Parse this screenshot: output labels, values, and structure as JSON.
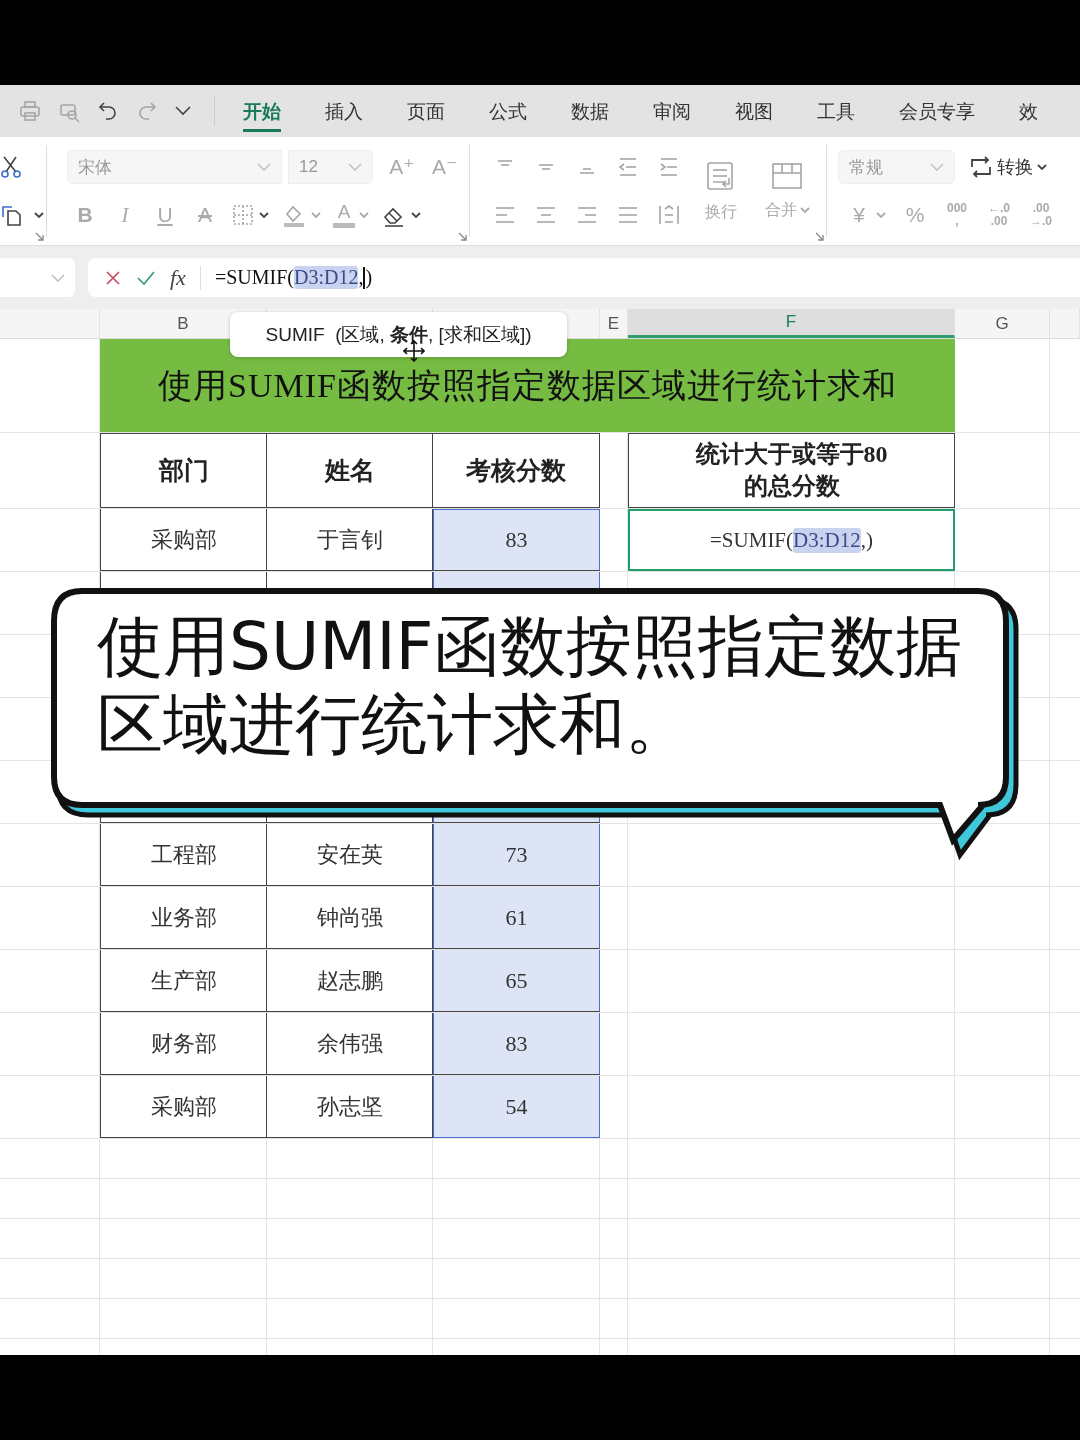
{
  "tabs": [
    {
      "label": "开始",
      "selected": true
    },
    {
      "label": "插入",
      "selected": false
    },
    {
      "label": "页面",
      "selected": false
    },
    {
      "label": "公式",
      "selected": false
    },
    {
      "label": "数据",
      "selected": false
    },
    {
      "label": "审阅",
      "selected": false
    },
    {
      "label": "视图",
      "selected": false
    },
    {
      "label": "工具",
      "selected": false
    },
    {
      "label": "会员专享",
      "selected": false
    },
    {
      "label": "效",
      "selected": false
    }
  ],
  "ribbon": {
    "font_name": "宋体",
    "font_size": "12",
    "font_size_buttons": [
      "A⁺",
      "A⁻"
    ],
    "style_buttons": [
      {
        "label": "B",
        "kind": "bold"
      },
      {
        "label": "I",
        "kind": "italic"
      },
      {
        "label": "U",
        "kind": "underline"
      },
      {
        "label": "A",
        "kind": "strike"
      }
    ],
    "font_color_label": "A",
    "wrap_label": "换行",
    "merge_label": "合并",
    "number_format": "常规",
    "convert_label": "转换",
    "currency": "¥",
    "percent": "%",
    "thousands": "000\n,",
    "decimals": [
      "←.0\n.00",
      ".00\n→.0"
    ]
  },
  "formula_bar": {
    "fx": "fx",
    "before": "=SUMIF(",
    "range": "D3:D12",
    "after": ",",
    "tail": ")"
  },
  "tooltip": "SUMIF  (区域, **条件**, [求和区域])",
  "column_headers": [
    {
      "label": "B",
      "selected": false
    },
    {
      "label": "E",
      "selected": false
    },
    {
      "label": "F",
      "selected": true
    },
    {
      "label": "G",
      "selected": false
    }
  ],
  "sheet": {
    "title": "使用SUMIF函数按照指定数据区域进行统计求和",
    "headers": [
      "部门",
      "姓名",
      "考核分数"
    ],
    "stat_header": "统计大于或等于80\n的总分数",
    "stat_formula": {
      "before": "=SUMIF(",
      "range": "D3:D12",
      "after": ",)"
    },
    "rows_top": [
      {
        "dept": "采购部",
        "name": "于言钊",
        "score": "83"
      }
    ],
    "rows_bottom": [
      {
        "dept": "工程部",
        "name": "安在英",
        "score": "73"
      },
      {
        "dept": "业务部",
        "name": "钟尚强",
        "score": "61"
      },
      {
        "dept": "生产部",
        "name": "赵志鹏",
        "score": "65"
      },
      {
        "dept": "财务部",
        "name": "余伟强",
        "score": "83"
      },
      {
        "dept": "采购部",
        "name": "孙志坚",
        "score": "54"
      }
    ]
  },
  "bubble_text": "使用SUMIF函数按照指定数据区域进行统计求和。"
}
